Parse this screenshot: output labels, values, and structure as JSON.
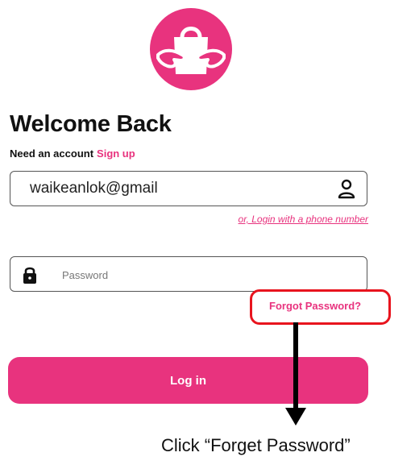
{
  "logo": {
    "icon": "shopping-bag-hug-icon",
    "color": "#e8337e"
  },
  "header": {
    "title": "Welcome Back",
    "need_account_text": "Need an account",
    "signup_label": "Sign up"
  },
  "email": {
    "value": "waikeanlok@gmail",
    "icon": "user-icon"
  },
  "phone_login_label": "or, Login with a phone number",
  "password": {
    "placeholder": "Password",
    "icon": "lock-icon"
  },
  "forgot_password_label": "Forgot Password?",
  "login_button_label": "Log in",
  "annotation": {
    "caption": "Click “Forget Password”",
    "highlight_color": "#e8141e"
  },
  "colors": {
    "accent": "#e8337e",
    "text": "#111111"
  }
}
